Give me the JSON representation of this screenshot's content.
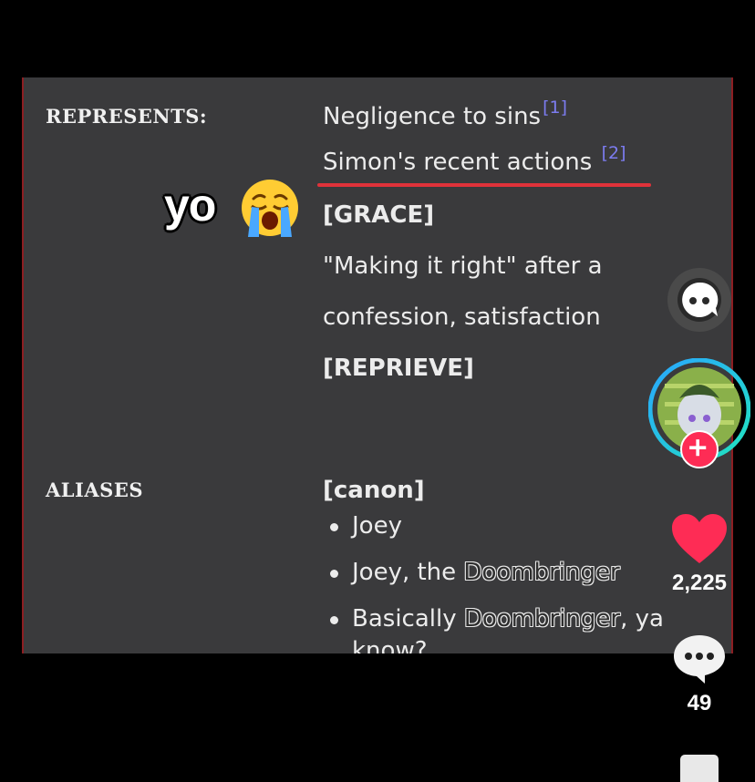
{
  "article": {
    "represents_label": "REPRESENTS:",
    "represents_line1": "Negligence to sins",
    "ref1": "[1]",
    "represents_line2": "Simon's recent actions",
    "ref2": "[2]",
    "grace_label": "[GRACE]",
    "grace_line1": "\"Making it right\" after a",
    "grace_line2": "confession, satisfaction",
    "reprieve_label": "[REPRIEVE]",
    "aliases_label": "ALIASES",
    "canon_label": "[canon]",
    "alias1": "Joey",
    "alias2_prefix": "Joey, the ",
    "alias2_term": "Doombringer",
    "alias3_prefix": "Basically ",
    "alias3_term": "Doombringer",
    "alias3_suffix": ", ya",
    "alias3_cont": "know?"
  },
  "overlay": {
    "caption": "yo",
    "emoji": "crying-face"
  },
  "sidebar": {
    "like_count": "2,225",
    "comment_count": "49",
    "icons": [
      "ai-chat-icon",
      "creator-avatar",
      "follow-plus-icon",
      "heart-icon",
      "comment-icon",
      "save-icon"
    ]
  },
  "colors": {
    "panel_bg": "#3a3a3c",
    "accent_red": "#e0323a",
    "ref_blue": "#7c7cf0",
    "like_red": "#fe2c55"
  }
}
